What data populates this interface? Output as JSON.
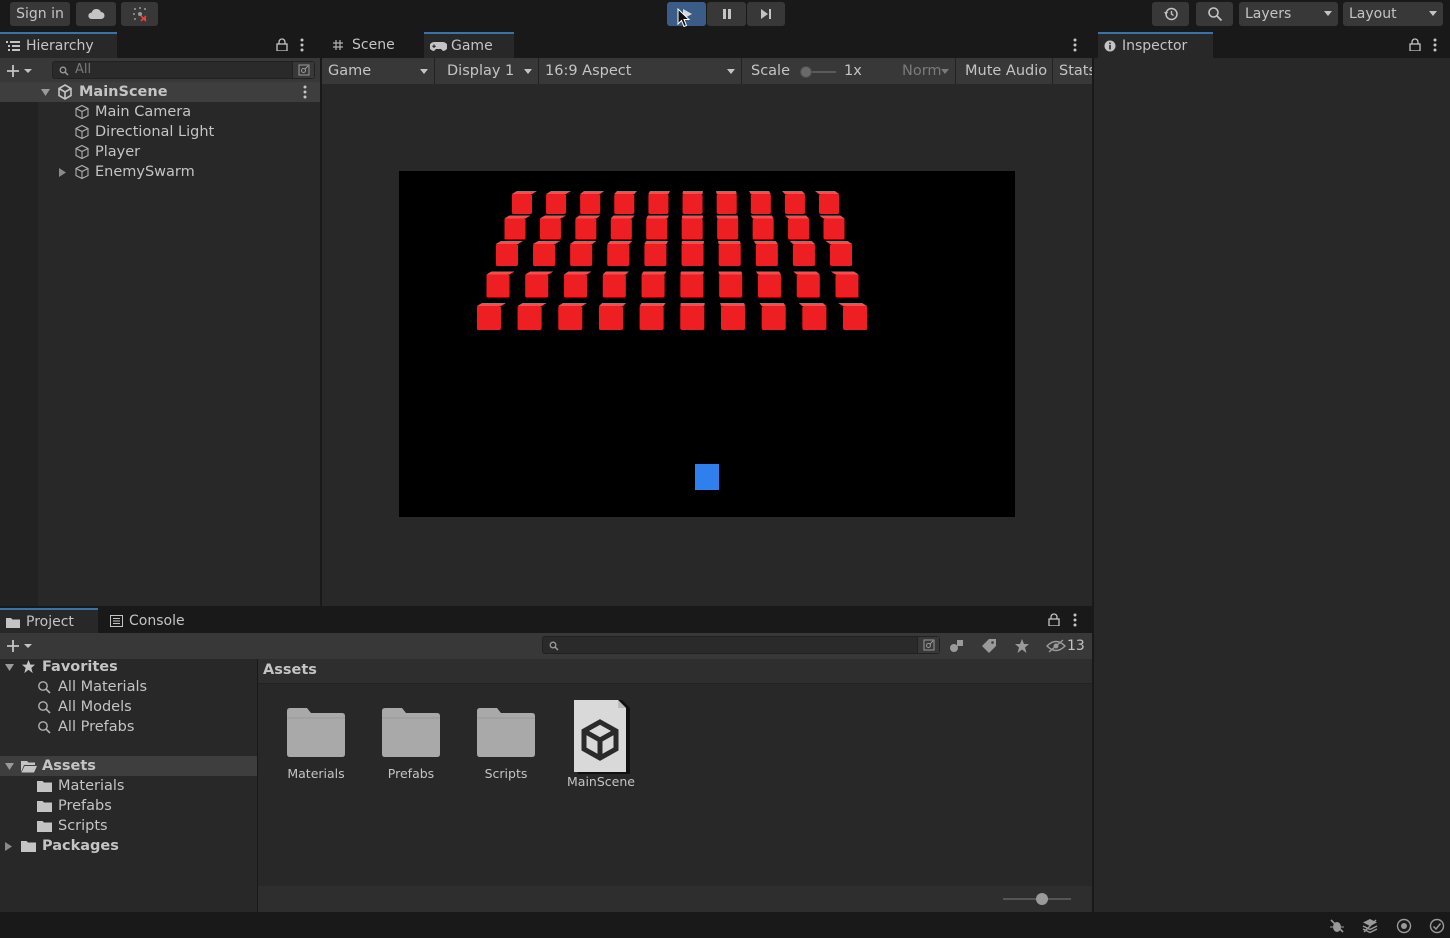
{
  "toolbar": {
    "sign_in": "Sign in",
    "layers": "Layers",
    "layout": "Layout",
    "play_state": "playing"
  },
  "hierarchy": {
    "tab": "Hierarchy",
    "search_placeholder": "All",
    "scene": "MainScene",
    "items": [
      {
        "label": "Main Camera",
        "icon": "gameobject-icon",
        "expandable": false
      },
      {
        "label": "Directional Light",
        "icon": "gameobject-icon",
        "expandable": false
      },
      {
        "label": "Player",
        "icon": "gameobject-icon",
        "expandable": false
      },
      {
        "label": "EnemySwarm",
        "icon": "gameobject-icon",
        "expandable": true
      }
    ]
  },
  "view": {
    "tabs": [
      {
        "label": "Scene",
        "icon": "hash-icon",
        "active": false
      },
      {
        "label": "Game",
        "icon": "gamepad-icon",
        "active": true
      }
    ],
    "game_bar": {
      "mode": "Game",
      "display": "Display 1",
      "aspect": "16:9 Aspect",
      "scale_label": "Scale",
      "scale_value": "1x",
      "norm": "Norm",
      "mute_audio": "Mute Audio",
      "stats": "Stats"
    },
    "game_view": {
      "background": "#000000",
      "enemy_color": "#ee1f22",
      "player_color": "#2f80ec",
      "enemy_rows": 5,
      "enemy_cols": 10
    }
  },
  "inspector": {
    "tab": "Inspector"
  },
  "project": {
    "tabs": [
      {
        "label": "Project",
        "icon": "folder-icon",
        "active": true
      },
      {
        "label": "Console",
        "icon": "console-icon",
        "active": false
      }
    ],
    "hidden_count": "13",
    "tree": {
      "favorites": "Favorites",
      "favorite_items": [
        "All Materials",
        "All Models",
        "All Prefabs"
      ],
      "assets": "Assets",
      "asset_items": [
        "Materials",
        "Prefabs",
        "Scripts"
      ],
      "packages": "Packages"
    },
    "breadcrumb": "Assets",
    "grid_items": [
      {
        "label": "Materials",
        "type": "folder"
      },
      {
        "label": "Prefabs",
        "type": "folder"
      },
      {
        "label": "Scripts",
        "type": "folder"
      },
      {
        "label": "MainScene",
        "type": "scene"
      }
    ]
  }
}
